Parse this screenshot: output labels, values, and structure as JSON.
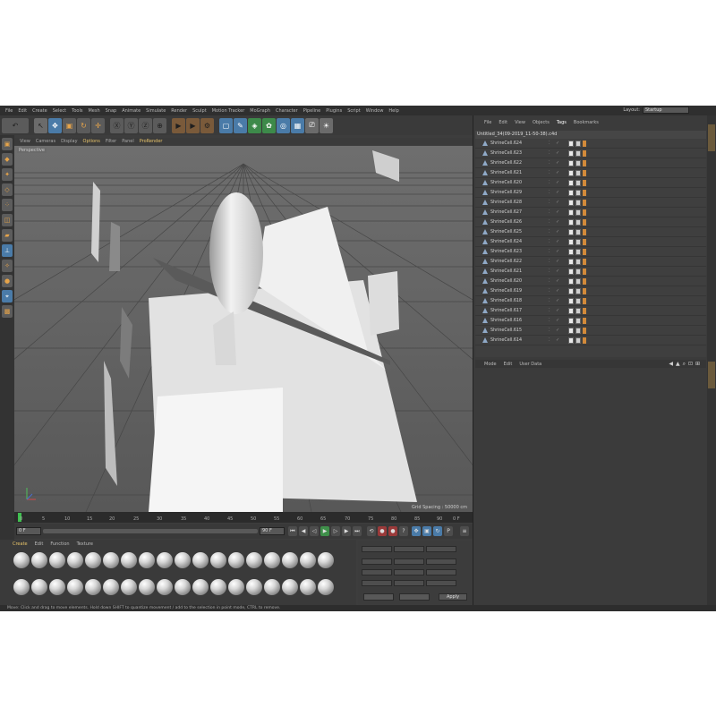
{
  "menubar": {
    "items": [
      "File",
      "Edit",
      "Create",
      "Select",
      "Tools",
      "Mesh",
      "Snap",
      "Animate",
      "Simulate",
      "Render",
      "Sculpt",
      "Motion Tracker",
      "MoGraph",
      "Character",
      "Pipeline",
      "Plugins",
      "Script",
      "Window",
      "Help"
    ],
    "layout_label": "Layout:",
    "layout_value": "Startup"
  },
  "viewport": {
    "menu": [
      "View",
      "Cameras",
      "Display",
      "Options",
      "Filter",
      "Panel",
      "ProRender"
    ],
    "label": "Perspective",
    "grid_spacing": "Grid Spacing : 50000 cm"
  },
  "timeline": {
    "ticks": [
      "0",
      "5",
      "10",
      "15",
      "20",
      "25",
      "30",
      "35",
      "40",
      "45",
      "50",
      "55",
      "60",
      "65",
      "70",
      "75",
      "80",
      "85",
      "90"
    ],
    "end_label": "0 F",
    "start_frame": "0 F",
    "end_frame": "90 F"
  },
  "materials": {
    "menu": [
      "Create",
      "Edit",
      "Function",
      "Texture"
    ],
    "count": 36
  },
  "attributes": {
    "apply_label": "Apply"
  },
  "objects": {
    "menu": [
      "File",
      "Edit",
      "View",
      "Objects",
      "Tags",
      "Bookmarks"
    ],
    "root": "Untitled_34(09-2019_11-50-38).c4d",
    "rows": [
      "ShrineCell.624",
      "ShrineCell.623",
      "ShrineCell.622",
      "ShrineCell.621",
      "ShrineCell.620",
      "ShrineCell.629",
      "ShrineCell.628",
      "ShrineCell.627",
      "ShrineCell.626",
      "ShrineCell.625",
      "ShrineCell.624",
      "ShrineCell.623",
      "ShrineCell.622",
      "ShrineCell.621",
      "ShrineCell.620",
      "ShrineCell.619",
      "ShrineCell.618",
      "ShrineCell.617",
      "ShrineCell.616",
      "ShrineCell.615",
      "ShrineCell.614"
    ]
  },
  "attr_manager": {
    "menu": [
      "Mode",
      "Edit",
      "User Data"
    ]
  },
  "status": {
    "text": "Move: Click and drag to move elements. Hold down SHIFT to quantize movement / add to the selection in point mode, CTRL to remove."
  },
  "colors": {
    "ui_bg": "#3d3d3d",
    "viewport_bg": "#5e5e5e",
    "accent": "#e8c46a",
    "active_tool": "#4a7ba8"
  }
}
